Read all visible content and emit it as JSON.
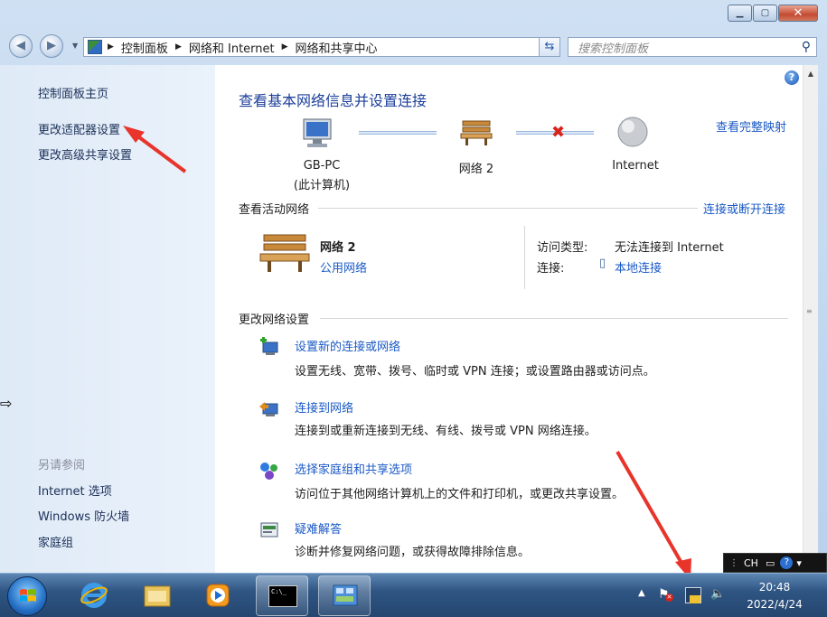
{
  "window": {
    "breadcrumb": [
      "控制面板",
      "网络和 Internet",
      "网络和共享中心"
    ],
    "search_placeholder": "搜索控制面板"
  },
  "left_pane": {
    "links": [
      "控制面板主页",
      "更改适配器设置",
      "更改高级共享设置"
    ],
    "see_also_title": "另请参阅",
    "see_also": [
      "Internet 选项",
      "Windows 防火墙",
      "家庭组"
    ]
  },
  "main": {
    "heading": "查看基本网络信息并设置连接",
    "full_map_link": "查看完整映射",
    "map": {
      "computer_name": "GB-PC",
      "computer_sub": "(此计算机)",
      "network_name": "网络  2",
      "internet": "Internet"
    },
    "active_networks": {
      "title": "查看活动网络",
      "connect_link": "连接或断开连接",
      "network_name": "网络  2",
      "network_type": "公用网络",
      "access_type_label": "访问类型:",
      "access_type_value": "无法连接到 Internet",
      "connection_label": "连接:",
      "connection_value": "本地连接"
    },
    "change_settings": {
      "title": "更改网络设置",
      "tasks": [
        {
          "icon": "new-connection-icon",
          "link": "设置新的连接或网络",
          "desc": "设置无线、宽带、拨号、临时或 VPN 连接；或设置路由器或访问点。"
        },
        {
          "icon": "connect-network-icon",
          "link": "连接到网络",
          "desc": "连接到或重新连接到无线、有线、拨号或 VPN 网络连接。"
        },
        {
          "icon": "homegroup-icon",
          "link": "选择家庭组和共享选项",
          "desc": "访问位于其他网络计算机上的文件和打印机，或更改共享设置。"
        },
        {
          "icon": "troubleshoot-icon",
          "link": "疑难解答",
          "desc": "诊断并修复网络问题，或获得故障排除信息。"
        }
      ]
    }
  },
  "language_bar": {
    "lang": "CH"
  },
  "taskbar": {
    "time": "20:48",
    "date": "2022/4/24",
    "cmd_label": "C:\\_"
  },
  "colors": {
    "link": "#1a59c6",
    "heading": "#1c3f9a",
    "annotation_arrow": "#e8342a"
  }
}
